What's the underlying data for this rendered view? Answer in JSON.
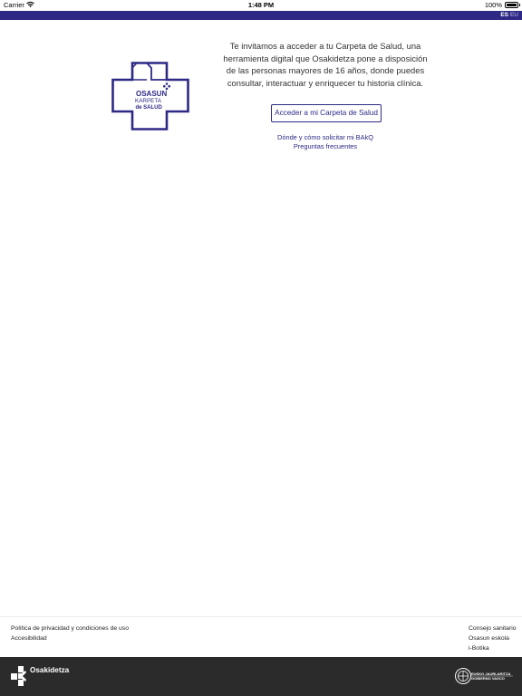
{
  "status_bar": {
    "carrier": "Carrier",
    "time": "1:48 PM",
    "battery": "100%"
  },
  "header": {
    "lang_es": "ES",
    "lang_eu": "EU"
  },
  "logo": {
    "line1": "OSASUN",
    "line2": "KARPETA",
    "line3": "de SALUD"
  },
  "main": {
    "intro": "Te invitamos a acceder a tu Carpeta de Salud, una herramienta digital que Osakidetza pone a disposición de las personas mayores de 16 años, donde puedes consultar, interactuar y enriquecer tu historia clínica.",
    "access_button": "Acceder a mi Carpeta de Salud",
    "link_bakq": "Dónde y cómo solicitar mi BAkQ",
    "link_faq": "Preguntas frecuentes"
  },
  "footer": {
    "left_links": [
      "Política de privacidad y condiciones de uso",
      "Accesibilidad"
    ],
    "right_links": [
      "Consejo sanitario",
      "Osasun eskola",
      "i-Botika"
    ],
    "brand": "Osakidetza",
    "gov_line1": "EUSKO JAURLARITZA",
    "gov_line2": "GOBIERNO VASCO"
  },
  "colors": {
    "brand_blue": "#2d2985",
    "footer_bg": "#2b2b2b"
  }
}
